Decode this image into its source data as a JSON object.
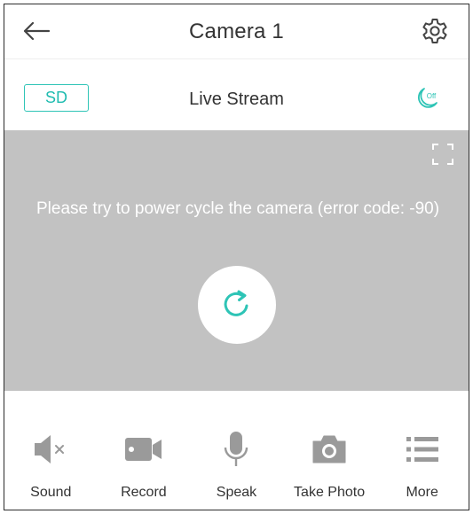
{
  "header": {
    "title": "Camera 1"
  },
  "stream": {
    "quality_label": "SD",
    "title": "Live Stream",
    "night_mode_badge": "Off"
  },
  "video": {
    "error_message": "Please try to power cycle the camera (error code: -90)"
  },
  "toolbar": {
    "items": [
      {
        "label": "Sound",
        "icon": "speaker-muted-icon"
      },
      {
        "label": "Record",
        "icon": "video-camera-icon"
      },
      {
        "label": "Speak",
        "icon": "microphone-icon"
      },
      {
        "label": "Take Photo",
        "icon": "camera-icon"
      },
      {
        "label": "More",
        "icon": "list-icon"
      }
    ]
  },
  "colors": {
    "accent": "#2ec4b6",
    "video_bg": "#c2c2c2",
    "icon_gray": "#9a9a9a"
  }
}
